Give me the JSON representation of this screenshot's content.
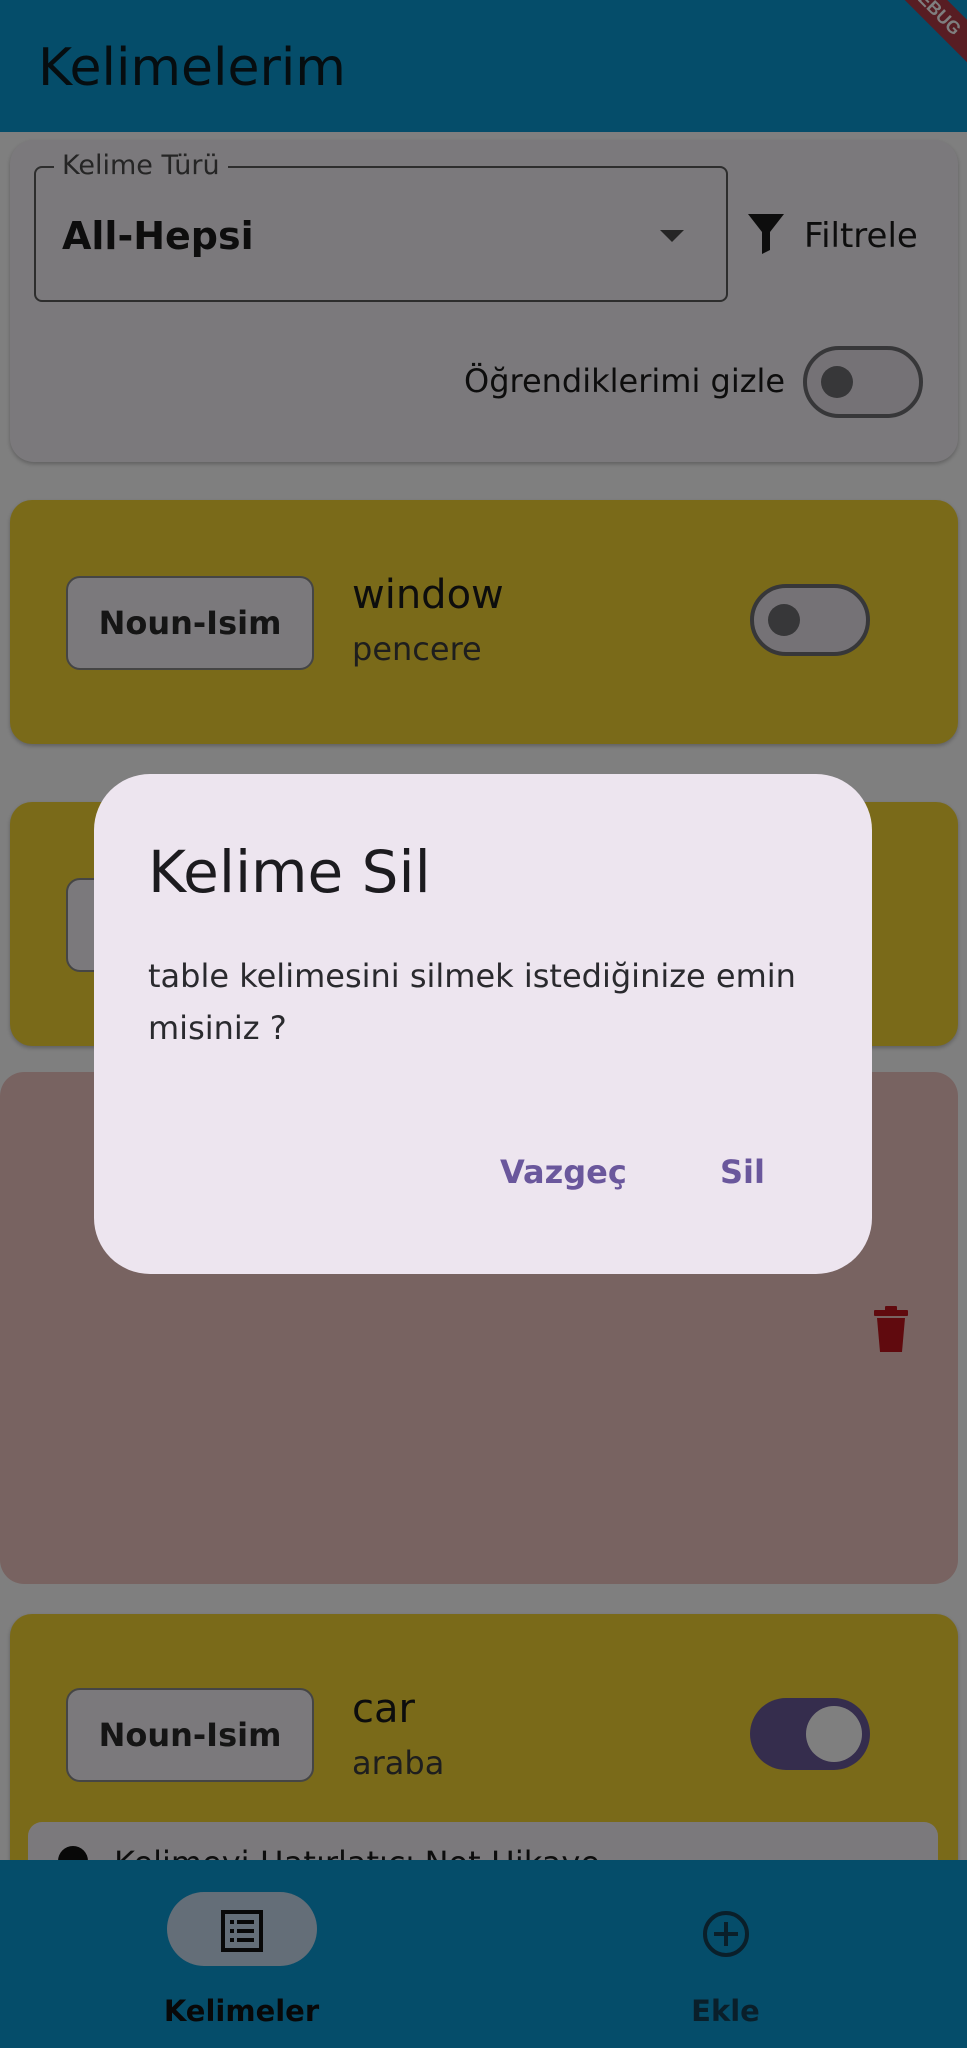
{
  "appbar": {
    "title": "Kelimelerim",
    "debug_banner": "DEBUG"
  },
  "filter": {
    "dropdown_label": "Kelime Türü",
    "dropdown_value": "All-Hepsi",
    "filter_button_label": "Filtrele",
    "hide_learned_label": "Öğrendiklerimi gizle",
    "hide_learned_on": false
  },
  "words": [
    {
      "type": "Noun-Isim",
      "word": "window",
      "meaning": "pencere",
      "learned": false
    },
    {
      "type": "Noun-Isim",
      "word": "car",
      "meaning": "araba",
      "learned": true,
      "note": "Kelimeyi Hatırlatıcı Not Hikaye"
    }
  ],
  "icons": {
    "filter": "filter-icon",
    "dropdown": "arrow-drop-down-icon",
    "delete": "trash-icon",
    "list": "list-icon",
    "add": "add-circle-icon"
  },
  "dialog": {
    "title": "Kelime Sil",
    "message": "table kelimesini silmek istediğinize emin misiniz ?",
    "cancel_label": "Vazgeç",
    "confirm_label": "Sil"
  },
  "bottom_nav": {
    "items": [
      {
        "label": "Kelimeler",
        "icon": "list-icon",
        "active": true
      },
      {
        "label": "Ekle",
        "icon": "add-circle-icon",
        "active": false
      }
    ]
  },
  "colors": {
    "primary": "#0a9ad4",
    "card": "#f5d532",
    "delete_background": "#f1c7c3",
    "delete_icon": "#c0141c",
    "dialog_button": "#6a579c"
  }
}
